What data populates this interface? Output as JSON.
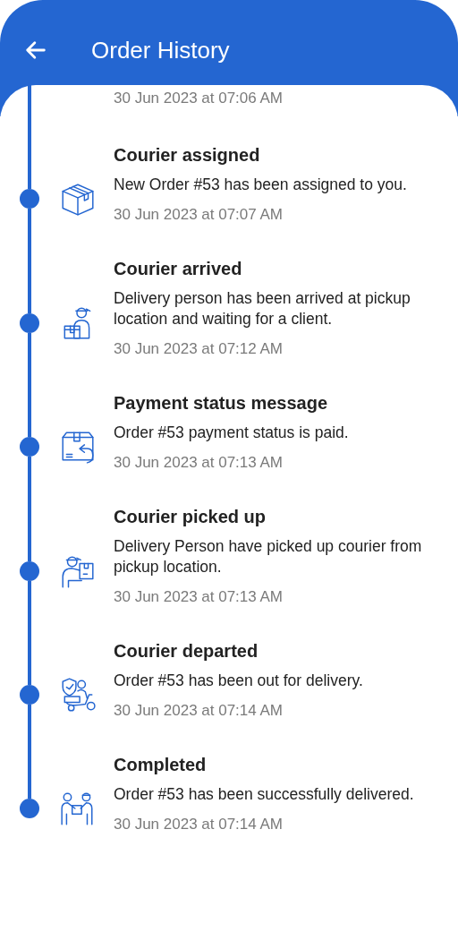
{
  "header": {
    "title": "Order History"
  },
  "previous_entry": {
    "time": "30 Jun 2023 at 07:06 AM"
  },
  "events": [
    {
      "kind": "box",
      "title": "Courier assigned",
      "message": "New Order #53 has been assigned to you.",
      "time": "30 Jun 2023 at 07:07 AM"
    },
    {
      "kind": "courier",
      "title": "Courier arrived",
      "message": "Delivery person has been arrived at pickup location and waiting for a client.",
      "time": "30 Jun 2023 at 07:12 AM"
    },
    {
      "kind": "return",
      "title": "Payment status message",
      "message": "Order #53 payment status is paid.",
      "time": "30 Jun 2023 at 07:13 AM"
    },
    {
      "kind": "pickup",
      "title": "Courier picked up",
      "message": "Delivery Person have picked up courier from pickup location.",
      "time": "30 Jun 2023 at 07:13 AM"
    },
    {
      "kind": "scooter",
      "title": "Courier departed",
      "message": "Order #53 has been out for delivery.",
      "time": "30 Jun 2023 at 07:14 AM"
    },
    {
      "kind": "handover",
      "title": "Completed",
      "message": "Order #53 has been successfully delivered.",
      "time": "30 Jun 2023 at 07:14 AM"
    }
  ]
}
